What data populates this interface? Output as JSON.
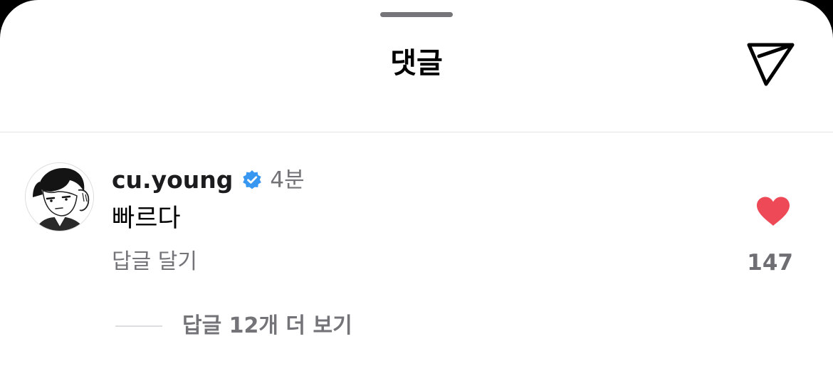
{
  "sheet": {
    "title": "댓글",
    "grabber_icon": "drag-handle",
    "share_icon": "paper-plane-icon"
  },
  "comment": {
    "username": "cu.young",
    "verified_icon": "verified-badge-icon",
    "time": "4분",
    "text": "빠르다",
    "reply_label": "답글 달기",
    "like_icon": "heart-filled-icon",
    "like_count": "147",
    "liked": true,
    "like_color": "#ed4956",
    "verified_color": "#3897f0"
  },
  "replies": {
    "more_label": "답글 12개 더 보기"
  }
}
